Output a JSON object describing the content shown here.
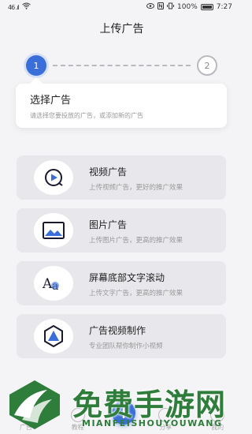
{
  "status_bar": {
    "left": "46 .ıl",
    "battery": "100%",
    "time": "7:27"
  },
  "header": {
    "title": "上传广告"
  },
  "stepper": {
    "step1": "1",
    "step2": "2"
  },
  "info_card": {
    "title": "选择广告",
    "description": "请选择您要投放的广告，或添加新的广告"
  },
  "options": [
    {
      "title": "视频广告",
      "description": "上传视频广告，更好的推广效果",
      "icon": "video-play-icon"
    },
    {
      "title": "图片广告",
      "description": "上传图片广告，更高的推广效果",
      "icon": "image-icon"
    },
    {
      "title": "屏幕底部文字滚动",
      "description": "上传文字广告，更高的推广效果",
      "icon": "text-aa-icon"
    },
    {
      "title": "广告视频制作",
      "description": "专业团队帮你制作小视频",
      "icon": "hexagon-triangle-icon"
    }
  ],
  "bottom_nav": [
    {
      "label": "广告"
    },
    {
      "label": "教程"
    },
    {
      "label": "分享"
    },
    {
      "label": "我的"
    }
  ],
  "fab": {
    "label": "+"
  },
  "watermark": {
    "text": "免费手游网",
    "sub": "MIANFEISHOUYOUWANG"
  },
  "colors": {
    "accent": "#3a6ed8",
    "card_bg": "#e8e8ec",
    "watermark": "#2f7d3a"
  }
}
